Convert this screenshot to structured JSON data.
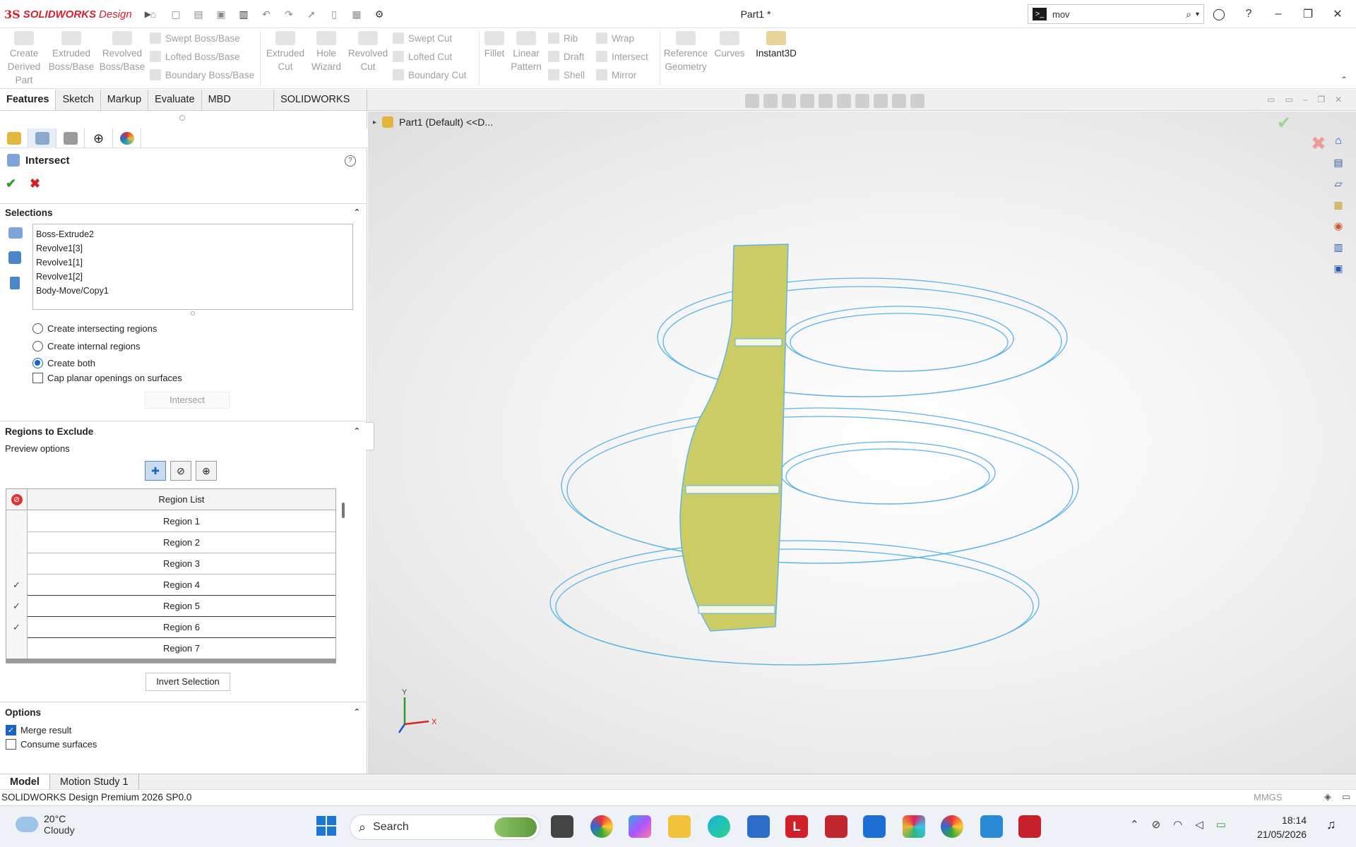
{
  "app": {
    "brand_ds": "3S",
    "brand_name": "SOLIDWORKS",
    "brand_suffix": "Design"
  },
  "title": "Part1 *",
  "search": {
    "value": "mov",
    "cmd_icon": ">_"
  },
  "ribbon": {
    "big_buttons": [
      {
        "label1": "Create",
        "label2": "Derived",
        "label3": "Part"
      },
      {
        "label1": "Extruded",
        "label2": "Boss/Base"
      },
      {
        "label1": "Revolved",
        "label2": "Boss/Base"
      },
      {
        "label1": "Extruded",
        "label2": "Cut"
      },
      {
        "label1": "Hole",
        "label2": "Wizard"
      },
      {
        "label1": "Revolved",
        "label2": "Cut"
      },
      {
        "label1": "Fillet"
      },
      {
        "label1": "Linear",
        "label2": "Pattern"
      },
      {
        "label1": "Reference",
        "label2": "Geometry"
      },
      {
        "label1": "Curves"
      },
      {
        "label1": "Instant3D"
      }
    ],
    "small_buttons": [
      "Swept Boss/Base",
      "Lofted Boss/Base",
      "Boundary Boss/Base",
      "Swept Cut",
      "Lofted Cut",
      "Boundary Cut",
      "Rib",
      "Wrap",
      "Draft",
      "Intersect",
      "Shell",
      "Mirror"
    ]
  },
  "tabs": [
    "Features",
    "Sketch",
    "Markup",
    "Evaluate",
    "MBD Dimensions",
    "SOLIDWORKS Add-Ins"
  ],
  "pm": {
    "title": "Intersect",
    "help": "?",
    "ok": "✔",
    "cancel": "✖",
    "selections_header": "Selections",
    "selections": [
      "Boss-Extrude2",
      "Revolve1[3]",
      "Revolve1[1]",
      "Revolve1[2]",
      "Body-Move/Copy1"
    ],
    "radio_options": [
      {
        "label": "Create intersecting regions",
        "checked": false
      },
      {
        "label": "Create internal regions",
        "checked": false
      },
      {
        "label": "Create both",
        "checked": true
      }
    ],
    "cap_label": "Cap planar openings on surfaces",
    "intersect_button": "Intersect",
    "regions_header": "Regions to Exclude",
    "preview_label": "Preview options",
    "region_list_header": "Region List",
    "regions": [
      {
        "label": "Region   1",
        "excluded": false
      },
      {
        "label": "Region   2",
        "excluded": false
      },
      {
        "label": "Region   3",
        "excluded": false
      },
      {
        "label": "Region   4",
        "excluded": true
      },
      {
        "label": "Region   5",
        "excluded": true
      },
      {
        "label": "Region   6",
        "excluded": true
      },
      {
        "label": "Region   7",
        "excluded": false
      }
    ],
    "invert_button": "Invert Selection",
    "options_header": "Options",
    "merge_label": "Merge result",
    "consume_label": "Consume surfaces"
  },
  "viewport": {
    "breadcrumb": "Part1  (Default) <<D...",
    "axis_y": "Y",
    "axis_x": "X"
  },
  "bottom_tabs": [
    "Model",
    "Motion Study 1"
  ],
  "status": {
    "text": "SOLIDWORKS Design Premium 2026 SP0.0",
    "units": "MMGS"
  },
  "taskbar": {
    "temp": "20°C",
    "weather": "Cloudy",
    "search": "Search",
    "time": "18:14",
    "date": "21/05/2026"
  },
  "colors": {
    "accent": "#1a63c7",
    "part_fill": "#cccc66",
    "ring_stroke": "#5ab4e8",
    "brand": "#d6202c"
  }
}
